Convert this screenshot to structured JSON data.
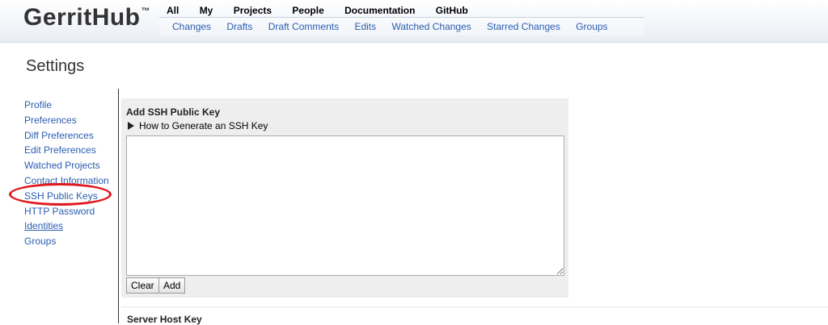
{
  "logo": {
    "text": "GerritHub",
    "tm": "™"
  },
  "top_menu": [
    "All",
    "My",
    "Projects",
    "People",
    "Documentation",
    "GitHub"
  ],
  "sub_menu": [
    "Changes",
    "Drafts",
    "Draft Comments",
    "Edits",
    "Watched Changes",
    "Starred Changes",
    "Groups"
  ],
  "page_title": "Settings",
  "sidebar": {
    "items": [
      "Profile",
      "Preferences",
      "Diff Preferences",
      "Edit Preferences",
      "Watched Projects",
      "Contact Information",
      "SSH Public Keys",
      "HTTP Password",
      "Identities",
      "Groups"
    ]
  },
  "panel": {
    "title": "Add SSH Public Key",
    "howto": "How to Generate an SSH Key",
    "textarea_value": "",
    "clear_label": "Clear",
    "add_label": "Add"
  },
  "server_host_key": {
    "title": "Server Host Key"
  },
  "colors": {
    "link": "#2a5db0",
    "highlight_circle": "#e0191f",
    "panel_bg": "#eeeeee"
  }
}
